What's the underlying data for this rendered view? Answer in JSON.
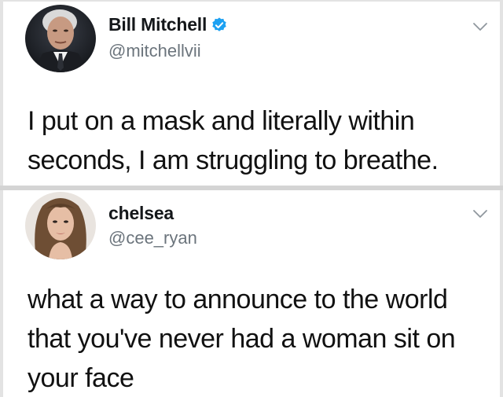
{
  "tweets": [
    {
      "display_name": "Bill Mitchell",
      "handle": "@mitchellvii",
      "verified": true,
      "text": "I put on a mask and literally within\nseconds, I am struggling to breathe.",
      "avatar_icon": "man-portrait-avatar",
      "menu_icon": "chevron-down-icon"
    },
    {
      "display_name": "chelsea",
      "handle": "@cee_ryan",
      "verified": false,
      "text": "what a way to announce to the world\nthat you've never had a woman sit on\nyour face",
      "avatar_icon": "woman-portrait-avatar",
      "menu_icon": "chevron-down-icon"
    }
  ],
  "colors": {
    "verified_badge": "#1da1f2",
    "handle_gray": "#6b747c",
    "text_dark": "#111111"
  }
}
